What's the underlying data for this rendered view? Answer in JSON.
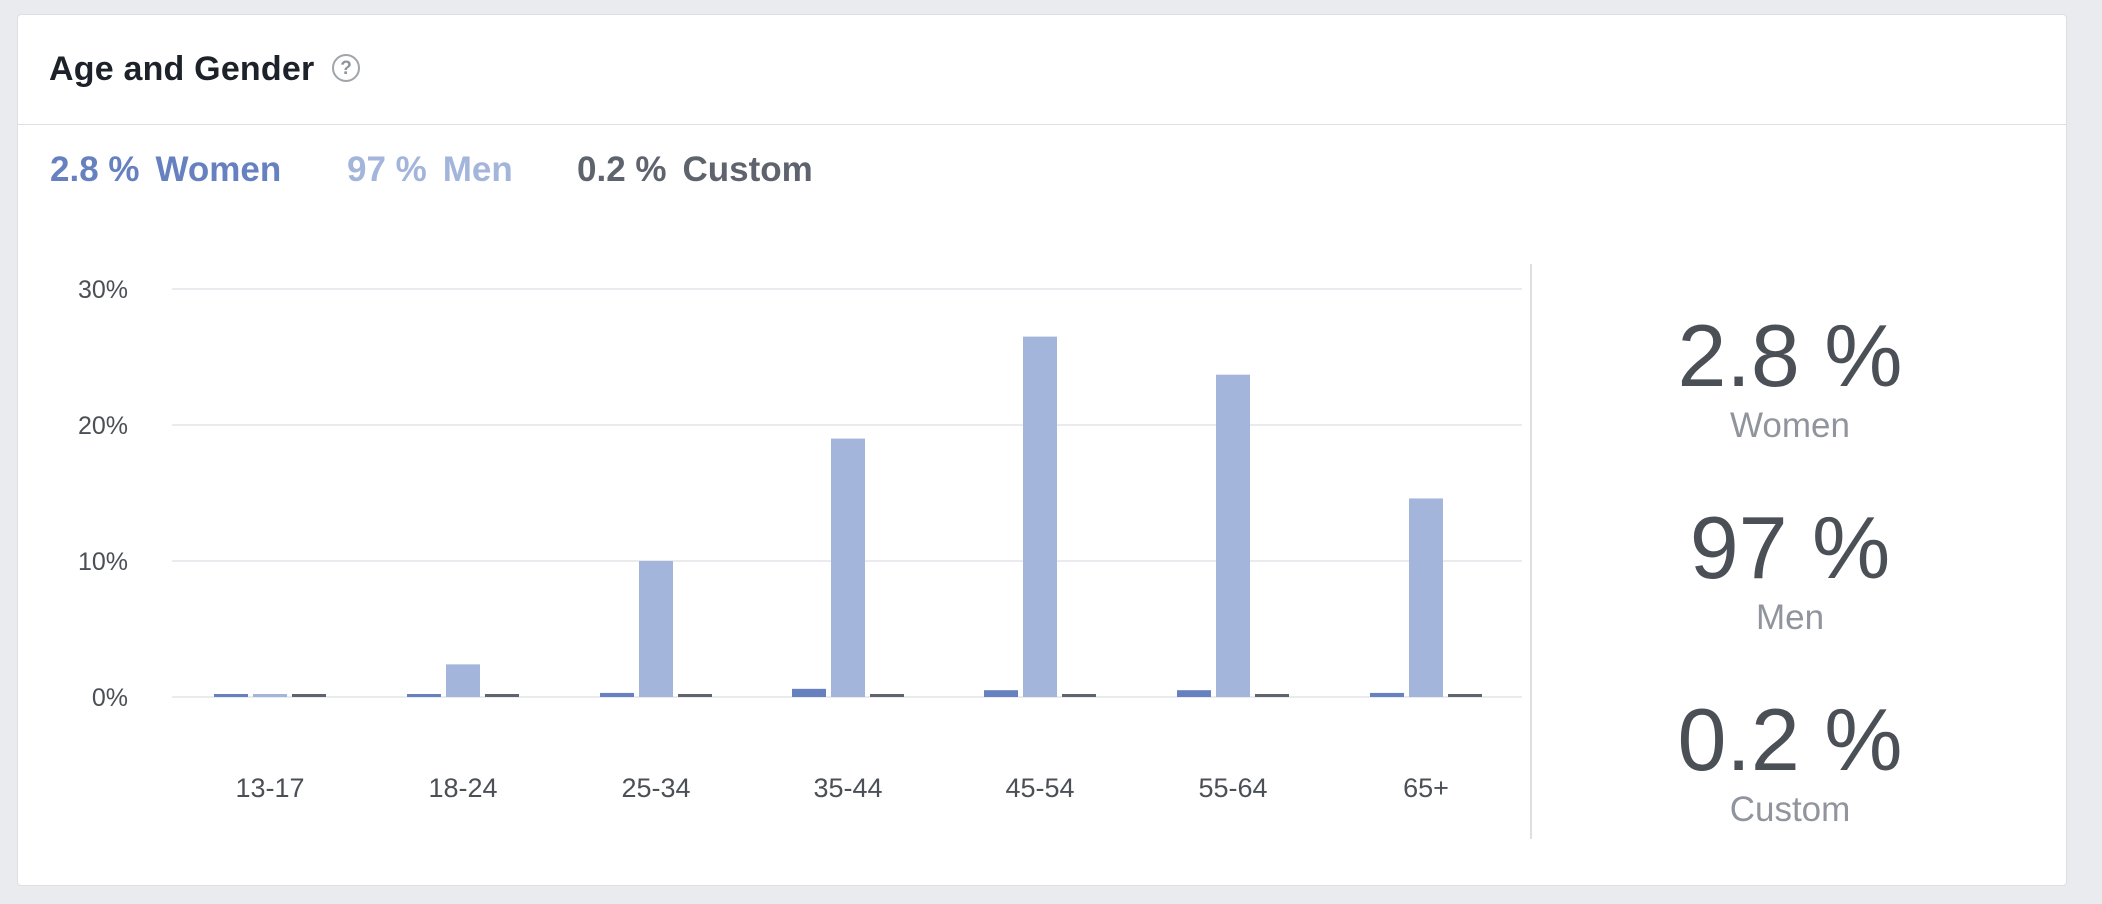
{
  "card": {
    "title": "Age and Gender"
  },
  "legend": [
    {
      "pct": "2.8 %",
      "label": "Women",
      "color": "#6680c0"
    },
    {
      "pct": "97 %",
      "label": "Men",
      "color": "#a3b5da"
    },
    {
      "pct": "0.2 %",
      "label": "Custom",
      "color": "#5e636e"
    }
  ],
  "summary": [
    {
      "value": "2.8 %",
      "label": "Women"
    },
    {
      "value": "97 %",
      "label": "Men"
    },
    {
      "value": "0.2 %",
      "label": "Custom"
    }
  ],
  "colors": {
    "women": "#6680c0",
    "men": "#a3b5da",
    "custom": "#5e636e",
    "grid": "#e9ebee"
  },
  "chart_data": {
    "type": "bar",
    "categories": [
      "13-17",
      "18-24",
      "25-34",
      "35-44",
      "45-54",
      "55-64",
      "65+"
    ],
    "series": [
      {
        "name": "Women",
        "values": [
          0.05,
          0.1,
          0.3,
          0.6,
          0.5,
          0.5,
          0.3
        ]
      },
      {
        "name": "Men",
        "values": [
          0.05,
          2.4,
          10,
          19,
          26.5,
          23.7,
          14.6
        ]
      },
      {
        "name": "Custom",
        "values": [
          0.02,
          0.02,
          0.02,
          0.02,
          0.02,
          0.02,
          0.02
        ]
      }
    ],
    "yticks": [
      "30%",
      "20%",
      "10%",
      "0%"
    ],
    "ytick_values": [
      30,
      20,
      10,
      0
    ],
    "ylim": [
      0,
      30
    ],
    "grid": true
  }
}
